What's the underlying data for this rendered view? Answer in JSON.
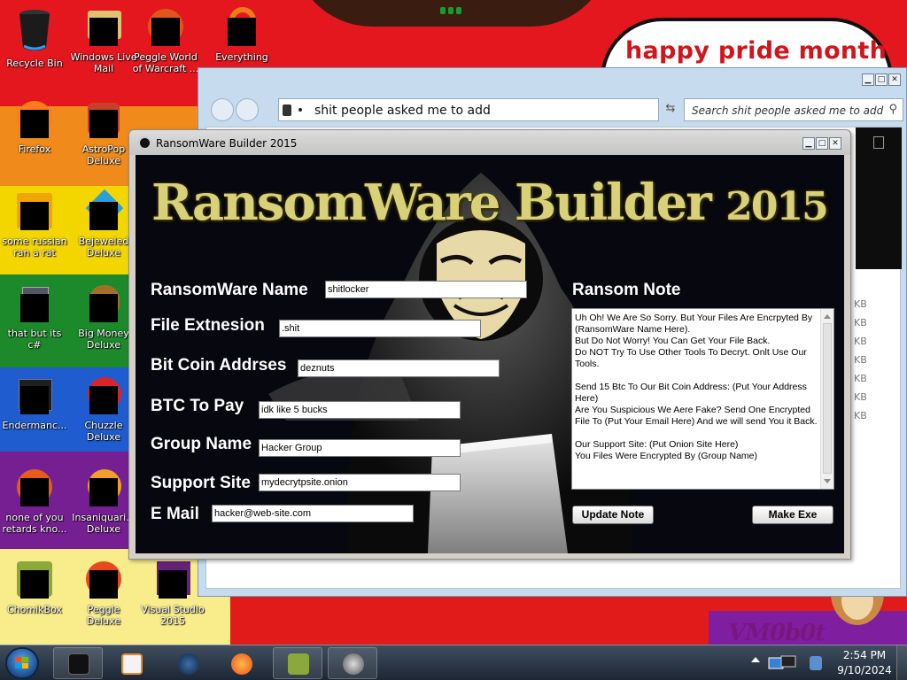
{
  "wallpaper": {
    "banner_text": "happy pride month",
    "watermark_text": "VM0b0t",
    "stripe_colors": [
      "#e4171f",
      "#f08a1a",
      "#f3d500",
      "#1c8a2b",
      "#1f5ccf",
      "#761f93"
    ]
  },
  "desktop_icons": [
    {
      "label": "Recycle Bin",
      "icon": "recycle-bin-icon"
    },
    {
      "label": "Windows Live Mail",
      "icon": "mail-icon"
    },
    {
      "label": "Peggle World of Warcraft ...",
      "icon": "peggle-wow-icon"
    },
    {
      "label": "Everything",
      "icon": "everything-search-icon"
    },
    {
      "label": "Firefox",
      "icon": "firefox-icon"
    },
    {
      "label": "AstroPop Deluxe",
      "icon": "astropop-icon"
    },
    {
      "label": "some russian ran a rat",
      "icon": "rat-icon"
    },
    {
      "label": "Bejeweled Deluxe",
      "icon": "bejeweled-icon"
    },
    {
      "label": "that but its c#",
      "icon": "csharp-icon"
    },
    {
      "label": "Big Money Deluxe",
      "icon": "bigmoney-icon"
    },
    {
      "label": "Endermanc...",
      "icon": "endermanch-icon"
    },
    {
      "label": "Chuzzle Deluxe",
      "icon": "chuzzle-icon"
    },
    {
      "label": "none of you retards kno...",
      "icon": "shortcut-icon"
    },
    {
      "label": "Insaniquari... Deluxe",
      "icon": "insaniquarium-icon"
    },
    {
      "label": "ChomikBox",
      "icon": "chomikbox-icon"
    },
    {
      "label": "Peggle Deluxe",
      "icon": "peggle-icon"
    },
    {
      "label": "Visual Studio 2015",
      "icon": "visual-studio-icon"
    }
  ],
  "explorer": {
    "address": "shit people asked me to add",
    "search_placeholder": "Search shit people asked me to add",
    "size_labels": [
      "KB",
      "KB",
      "KB",
      "KB",
      "KB",
      "KB",
      "KB"
    ]
  },
  "ransomware_builder": {
    "window_title": "RansomWare Builder 2015",
    "banner_main": "RansomWare Builder",
    "banner_year": "2015",
    "fields": {
      "name": {
        "label": "RansomWare Name",
        "value": "shitlocker"
      },
      "file_ext": {
        "label": "File Extnesion",
        "value": ".shit"
      },
      "btc_address": {
        "label": "Bit Coin Addrses",
        "value": "deznuts"
      },
      "btc_pay": {
        "label": "BTC To Pay",
        "value": "idk like 5 bucks"
      },
      "group": {
        "label": "Group Name",
        "value": "Hacker Group"
      },
      "support": {
        "label": "Support Site",
        "value": "mydecrytpsite.onion"
      },
      "email": {
        "label": "E Mail",
        "value": "hacker@web-site.com"
      }
    },
    "note_title": "Ransom Note",
    "note_lines": [
      "Uh Oh! We Are So Sorry. But Your Files Are Encrpyted By (RansomWare Name Here).",
      "But Do Not Worry! You Can Get Your File Back.",
      "Do NOT Try To Use Other Tools To Decryt. Onlt Use Our Tools.",
      "",
      "Send 15 Btc To Our Bit Coin Address: (Put Your Address Here)",
      "Are You Suspicious We Aere Fake? Send One Encrypted File To (Put Your Email Here) And we will send You it Back.",
      "",
      "Our Support Site: (Put Onion Site Here)",
      "You Files Were Encrypted By (Group Name)"
    ],
    "update_button": "Update Note",
    "make_button": "Make Exe"
  },
  "taskbar": {
    "items": [
      "start-button",
      "terminal-app",
      "media-player",
      "globe-app",
      "firefox",
      "chomikbox",
      "tool-app"
    ],
    "clock_time": "2:54 PM",
    "clock_date": "9/10/2024"
  }
}
